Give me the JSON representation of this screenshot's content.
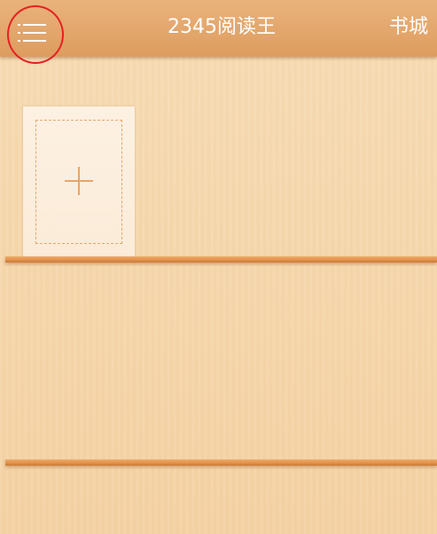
{
  "header": {
    "title": "2345阅读王",
    "store_label": "书城",
    "menu_icon": "menu-icon"
  },
  "bookshelf": {
    "add_book_icon": "plus-icon"
  },
  "colors": {
    "header_bg": "#dd9c5f",
    "shelf": "#e08f4a",
    "wood_bg": "#f6d7ad",
    "accent": "#e4a66c",
    "highlight_circle": "#e32222"
  }
}
